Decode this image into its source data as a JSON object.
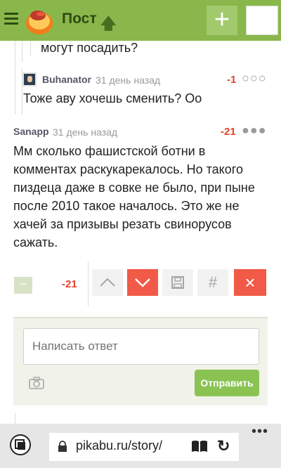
{
  "header": {
    "title": "Пост",
    "plus_label": "+"
  },
  "comments": [
    {
      "text": "могут посадить?"
    },
    {
      "author": "Buhanator",
      "time": "31 день назад",
      "rating": "-1",
      "text": "Тоже аву хочешь сменить?  Оо"
    },
    {
      "author": "Sanapp",
      "time": "31 день назад",
      "rating": "-21",
      "text_lines": [
        "Мм сколько фашистской ботни в",
        "комментах раскукарекалось. Но такого",
        "пиздеца даже в совке не было, при пыне",
        "после 2010 такое началось. Это же не",
        "хачей за призывы резать свинорусов",
        "сажать."
      ]
    }
  ],
  "actions": {
    "minus_label": "−",
    "rating": "-21",
    "hash_label": "#",
    "close_label": "×"
  },
  "reply": {
    "placeholder": "Написать ответ",
    "send_label": "Отправить"
  },
  "browser": {
    "url": "pikabu.ru/story/",
    "more_label": "•••",
    "reload_label": "↻"
  },
  "colors": {
    "accent": "#8ab74b",
    "danger": "#f15a46",
    "send": "#8ac352"
  }
}
